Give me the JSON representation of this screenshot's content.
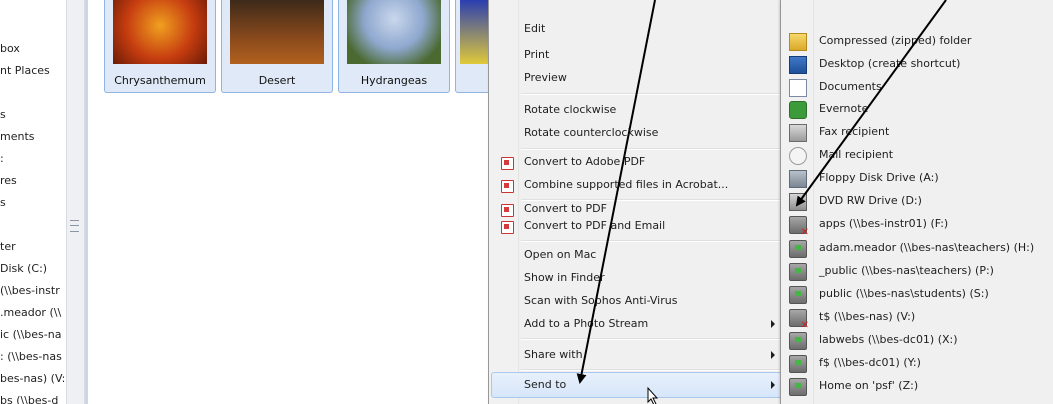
{
  "nav": {
    "items": [
      "box",
      "nt Places",
      "s",
      "ments",
      ":",
      "res",
      "s",
      "ter",
      " Disk (C:)",
      "(\\\\bes-instr",
      ".meador (\\\\",
      "ic (\\\\bes-na",
      ": (\\\\bes-nas",
      "bes-nas) (V:",
      "bs (\\\\bes-d"
    ]
  },
  "thumbnails": [
    "Chrysanthemum",
    "Desert",
    "Hydrangeas"
  ],
  "context_menu": {
    "items": [
      "Edit",
      "Print",
      "Preview",
      "Rotate clockwise",
      "Rotate counterclockwise",
      "Convert to Adobe PDF",
      "Combine supported files in Acrobat...",
      "Convert to PDF",
      "Convert to PDF and Email",
      "Open on Mac",
      "Show in Finder",
      "Scan with Sophos Anti-Virus",
      "Add to a Photo Stream",
      "Share with",
      "Send to"
    ]
  },
  "send_to_menu": {
    "items": [
      {
        "label": "Compressed (zipped) folder",
        "icon": "zip-folder-icon"
      },
      {
        "label": "Desktop (create shortcut)",
        "icon": "desktop-icon"
      },
      {
        "label": "Documents",
        "icon": "documents-icon"
      },
      {
        "label": "Evernote",
        "icon": "evernote-icon"
      },
      {
        "label": "Fax recipient",
        "icon": "fax-icon"
      },
      {
        "label": "Mail recipient",
        "icon": "mail-icon"
      },
      {
        "label": "Floppy Disk Drive (A:)",
        "icon": "floppy-drive-icon"
      },
      {
        "label": "DVD RW Drive (D:)",
        "icon": "dvd-drive-icon"
      },
      {
        "label": "apps (\\\\bes-instr01) (F:)",
        "icon": "network-drive-disconnected-icon"
      },
      {
        "label": "adam.meador (\\\\bes-nas\\teachers) (H:)",
        "icon": "network-drive-icon"
      },
      {
        "label": "_public (\\\\bes-nas\\teachers) (P:)",
        "icon": "network-drive-icon"
      },
      {
        "label": "public (\\\\bes-nas\\students) (S:)",
        "icon": "network-drive-icon"
      },
      {
        "label": "t$ (\\\\bes-nas) (V:)",
        "icon": "network-drive-disconnected-icon"
      },
      {
        "label": "labwebs (\\\\bes-dc01) (X:)",
        "icon": "network-drive-icon"
      },
      {
        "label": "f$ (\\\\bes-dc01) (Y:)",
        "icon": "network-drive-icon"
      },
      {
        "label": "Home on 'psf' (Z:)",
        "icon": "network-drive-icon"
      }
    ]
  },
  "colors": {
    "highlight": "#d6e6fa",
    "menu_bg": "#f0f0f0",
    "thumb_selected": "#dfe9f7"
  }
}
